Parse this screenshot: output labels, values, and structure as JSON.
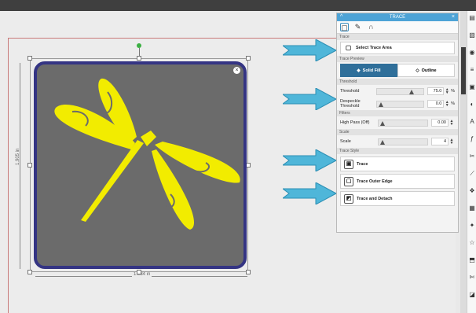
{
  "canvas": {
    "width_label": "1.934 in",
    "height_label": "1.905 in"
  },
  "panel": {
    "title": "TRACE",
    "collapse_glyph": "^",
    "close_glyph": "×",
    "tools": [
      "select-area-tool",
      "eyedropper-tool",
      "magnet-tool"
    ],
    "sections": {
      "trace": "Trace",
      "trace_preview": "Trace Preview",
      "threshold": "Threshold",
      "filters": "Filters",
      "scale": "Scale",
      "trace_style": "Trace Style"
    },
    "select_trace_area_label": "Select Trace Area",
    "preview": {
      "solid_fill_label": "Solid Fill",
      "outline_label": "Outline",
      "selected": "Solid Fill"
    },
    "threshold": {
      "label": "Threshold",
      "value": "75.0",
      "unit": "%",
      "level": 0.75
    },
    "despeckle": {
      "label": "Despeckle Threshold",
      "value": "0.0",
      "unit": "%",
      "level": 0.0
    },
    "high_pass": {
      "label": "High Pass (Off)",
      "value": "0.00",
      "level": 0.0
    },
    "scale": {
      "label": "Scale",
      "value": "4",
      "level": 0.0
    },
    "style_buttons": {
      "trace": "Trace",
      "trace_outer_edge": "Trace Outer Edge",
      "trace_and_detach": "Trace and Detach"
    }
  },
  "colors": {
    "panel_header": "#4da3d6",
    "artwork_fill": "#f2ec00",
    "artwork_bg": "#6b6b6b",
    "artwork_border": "#343483",
    "arrow": "#4fb6d9"
  },
  "right_toolbar": [
    "page-setup-icon",
    "image-icon",
    "fill-icon",
    "line-icon",
    "trace-icon",
    "contrast-icon",
    "text-icon",
    "font-icon",
    "scissors-icon",
    "knife-icon",
    "replicate-icon",
    "library-icon",
    "wand-icon",
    "star-icon",
    "transform-icon",
    "cut-icon",
    "eraser-icon"
  ]
}
